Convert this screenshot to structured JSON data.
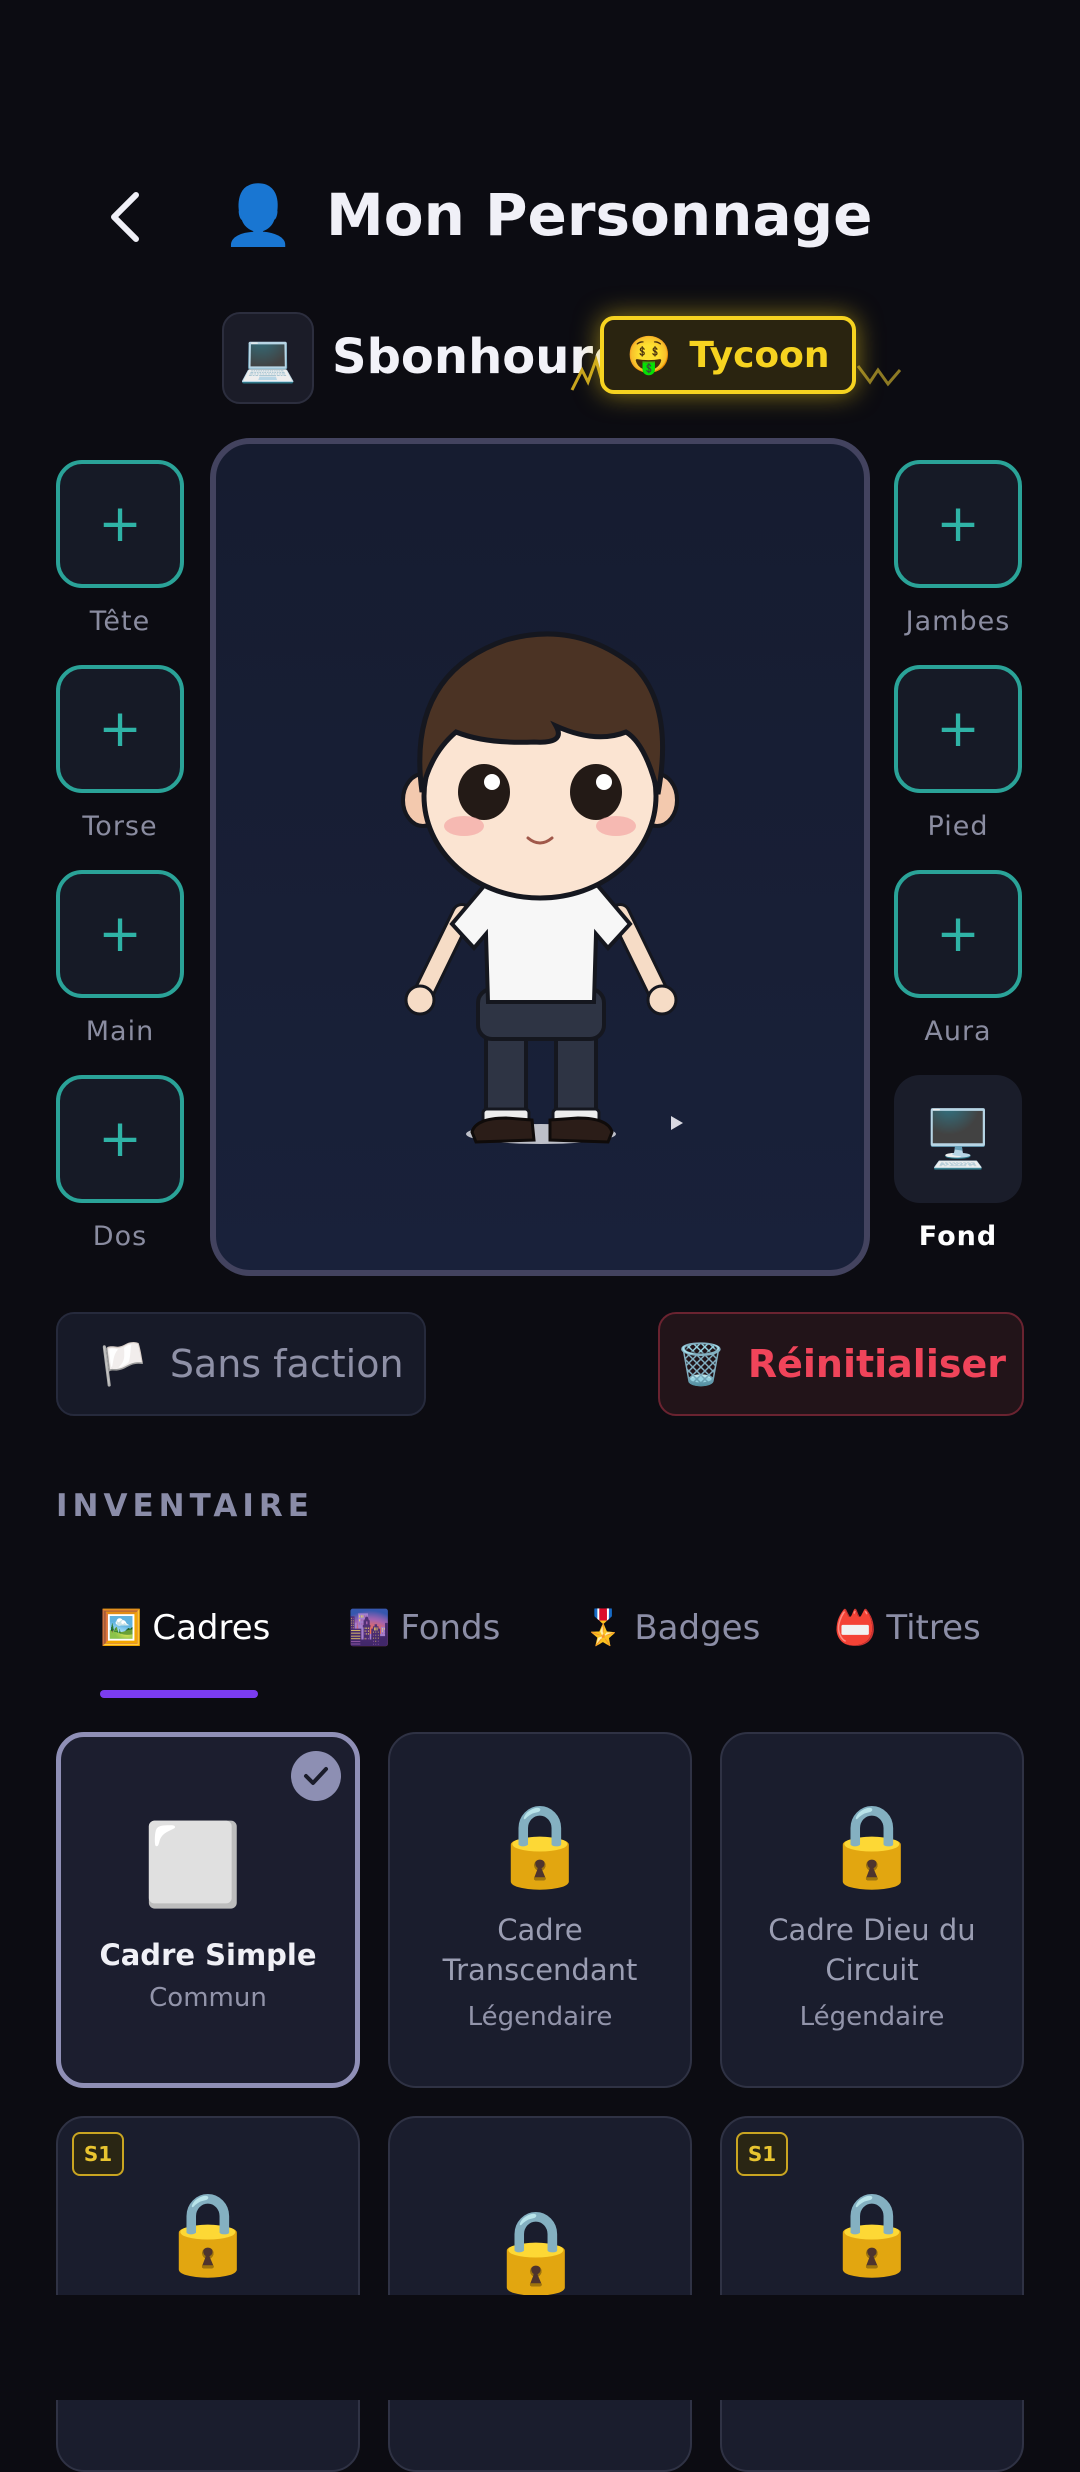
{
  "header": {
    "title_icon": "👤",
    "title": "Mon Personnage"
  },
  "profile": {
    "device_icon": "💻",
    "username": "Sbonhoure",
    "title_badge": {
      "emoji": "🤑",
      "label": "Tycoon",
      "color": "#f6d320"
    }
  },
  "slots": {
    "left": [
      {
        "label": "Tête",
        "icon": "plus-icon"
      },
      {
        "label": "Torse",
        "icon": "plus-icon"
      },
      {
        "label": "Main",
        "icon": "plus-icon"
      },
      {
        "label": "Dos",
        "icon": "plus-icon"
      }
    ],
    "right": [
      {
        "label": "Jambes",
        "icon": "plus-icon"
      },
      {
        "label": "Pied",
        "icon": "plus-icon"
      },
      {
        "label": "Aura",
        "icon": "plus-icon"
      },
      {
        "label": "Fond",
        "icon": "🖥️"
      }
    ]
  },
  "actions": {
    "faction": {
      "icon": "🏳️",
      "label": "Sans faction"
    },
    "reset": {
      "icon": "🗑️",
      "label": "Réinitialiser",
      "color": "#f0445a"
    }
  },
  "inventory": {
    "title": "INVENTAIRE",
    "tabs": [
      {
        "icon": "🖼️",
        "label": "Cadres",
        "active": true
      },
      {
        "icon": "🌆",
        "label": "Fonds"
      },
      {
        "icon": "🎖️",
        "label": "Badges"
      },
      {
        "icon": "📛",
        "label": "Titres"
      }
    ],
    "accent": "#7b3cf0",
    "cards": [
      {
        "icon": "⬜",
        "name": "Cadre Simple",
        "rarity": "Commun",
        "selected": true
      },
      {
        "icon": "🔒",
        "name": "Cadre Transcendant",
        "rarity": "Légendaire"
      },
      {
        "icon": "🔒",
        "name": "Cadre Dieu du Circuit",
        "rarity": "Légendaire"
      },
      {
        "icon": "🔒",
        "badge": "S1"
      },
      {
        "icon": "🔒"
      },
      {
        "icon": "🔒",
        "badge": "S1"
      }
    ]
  }
}
